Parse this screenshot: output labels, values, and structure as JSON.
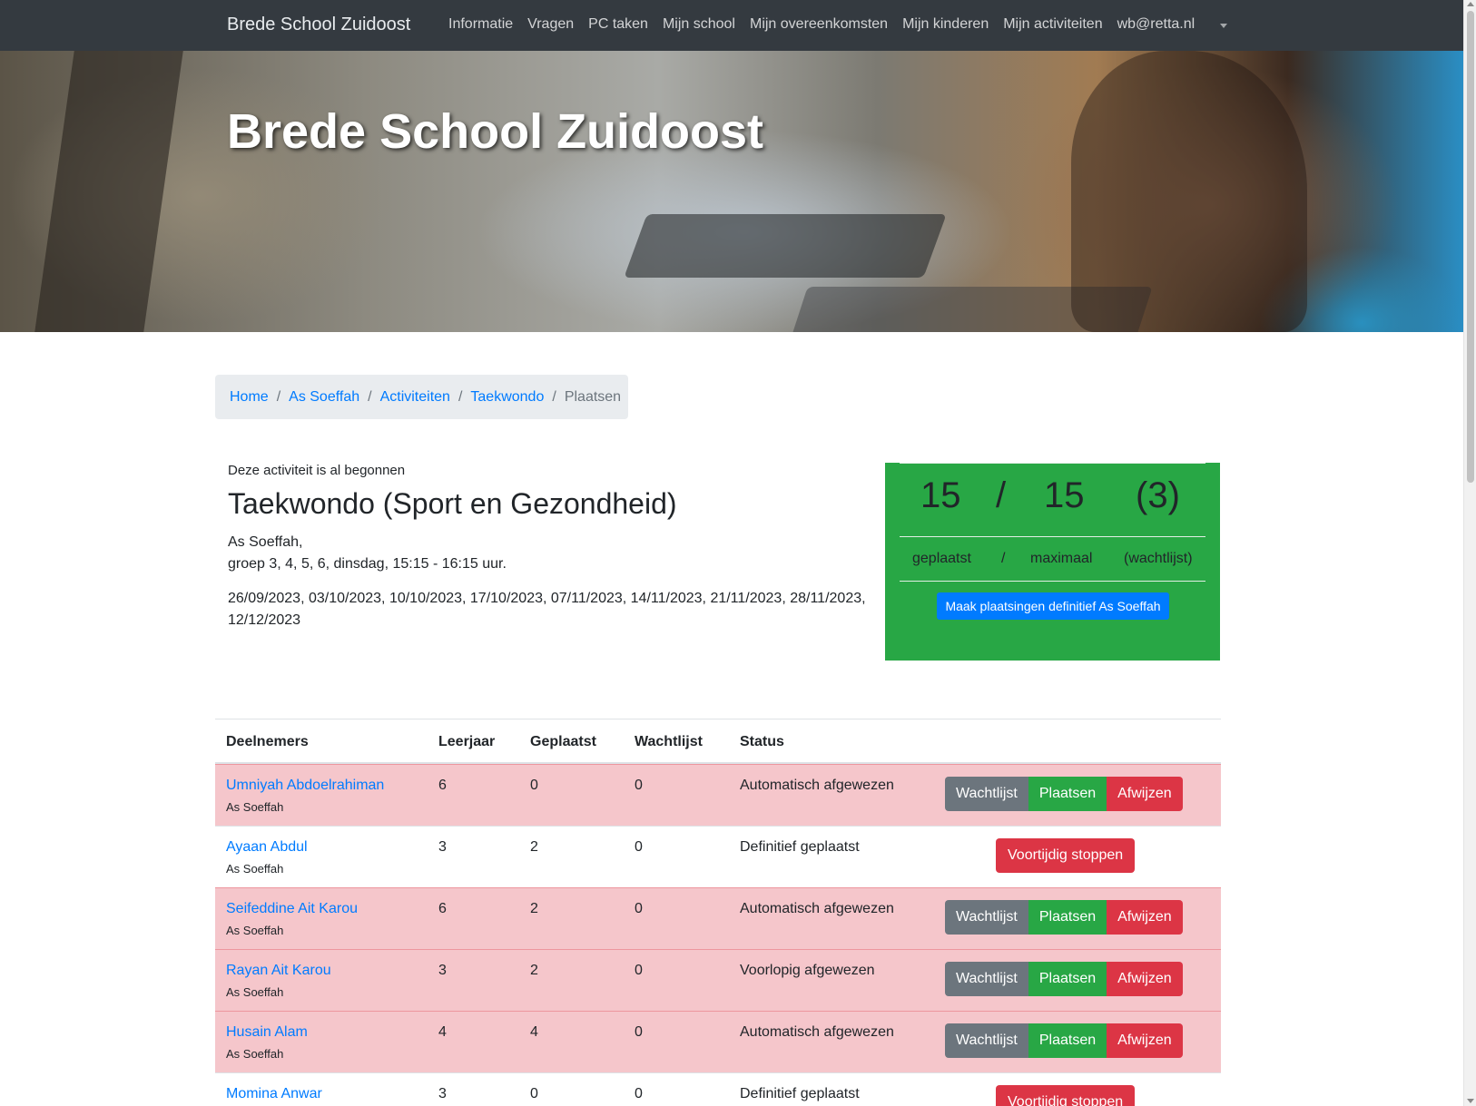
{
  "navbar": {
    "brand": "Brede School Zuidoost",
    "items": [
      {
        "label": "Informatie"
      },
      {
        "label": "Vragen"
      },
      {
        "label": "PC taken"
      },
      {
        "label": "Mijn school"
      },
      {
        "label": "Mijn overeenkomsten"
      },
      {
        "label": "Mijn kinderen"
      },
      {
        "label": "Mijn activiteiten"
      },
      {
        "label": "wb@retta.nl"
      }
    ]
  },
  "hero": {
    "title": "Brede School Zuidoost"
  },
  "breadcrumb": {
    "items": [
      {
        "label": "Home"
      },
      {
        "label": "As Soeffah"
      },
      {
        "label": "Activiteiten"
      },
      {
        "label": "Taekwondo"
      }
    ],
    "separator": "/",
    "active": "Plaatsen"
  },
  "activity": {
    "status": "Deze activiteit is al begonnen",
    "title": "Taekwondo (Sport en Gezondheid)",
    "school": "As Soeffah,",
    "group": "groep 3, 4, 5, 6, dinsdag, 15:15 - 16:15 uur.",
    "dates": "26/09/2023, 03/10/2023, 10/10/2023, 17/10/2023, 07/11/2023, 14/11/2023, 21/11/2023, 28/11/2023, 12/12/2023"
  },
  "stats": {
    "placed": "15",
    "separator": "/",
    "maximum": "15",
    "waitlist": "(3)",
    "placed_label": "geplaatst",
    "maximum_label": "maximaal",
    "waitlist_label": "(wachtlijst)",
    "finalize_button": "Maak plaatsingen definitief As Soeffah"
  },
  "table": {
    "headers": [
      "Deelnemers",
      "Leerjaar",
      "Geplaatst",
      "Wachtlijst",
      "Status"
    ],
    "rows": [
      {
        "name": "Umniyah Abdoelrahiman",
        "school": "As Soeffah",
        "year": "6",
        "placed": "0",
        "waitlist": "0",
        "status": "Automatisch afgewezen"
      },
      {
        "name": "Ayaan Abdul",
        "school": "As Soeffah",
        "year": "3",
        "placed": "2",
        "waitlist": "0",
        "status": "Definitief geplaatst"
      },
      {
        "name": "Seifeddine Ait Karou",
        "school": "As Soeffah",
        "year": "6",
        "placed": "2",
        "waitlist": "0",
        "status": "Automatisch afgewezen"
      },
      {
        "name": "Rayan Ait Karou",
        "school": "As Soeffah",
        "year": "3",
        "placed": "2",
        "waitlist": "0",
        "status": "Voorlopig afgewezen"
      },
      {
        "name": "Husain Alam",
        "school": "As Soeffah",
        "year": "4",
        "placed": "4",
        "waitlist": "0",
        "status": "Automatisch afgewezen"
      },
      {
        "name": "Momina Anwar",
        "school": "",
        "year": "3",
        "placed": "0",
        "waitlist": "0",
        "status": "Definitief geplaatst"
      }
    ],
    "buttons": {
      "waitlist": "Wachtlijst",
      "place": "Plaatsen",
      "reject": "Afwijzen",
      "stop": "Voortijdig stoppen"
    }
  },
  "colors": {
    "navbar": "#343a40",
    "link": "#007bff",
    "success": "#28a745",
    "danger": "#dc3545",
    "secondary": "#6c757d",
    "row_danger": "#f5c6cb"
  }
}
